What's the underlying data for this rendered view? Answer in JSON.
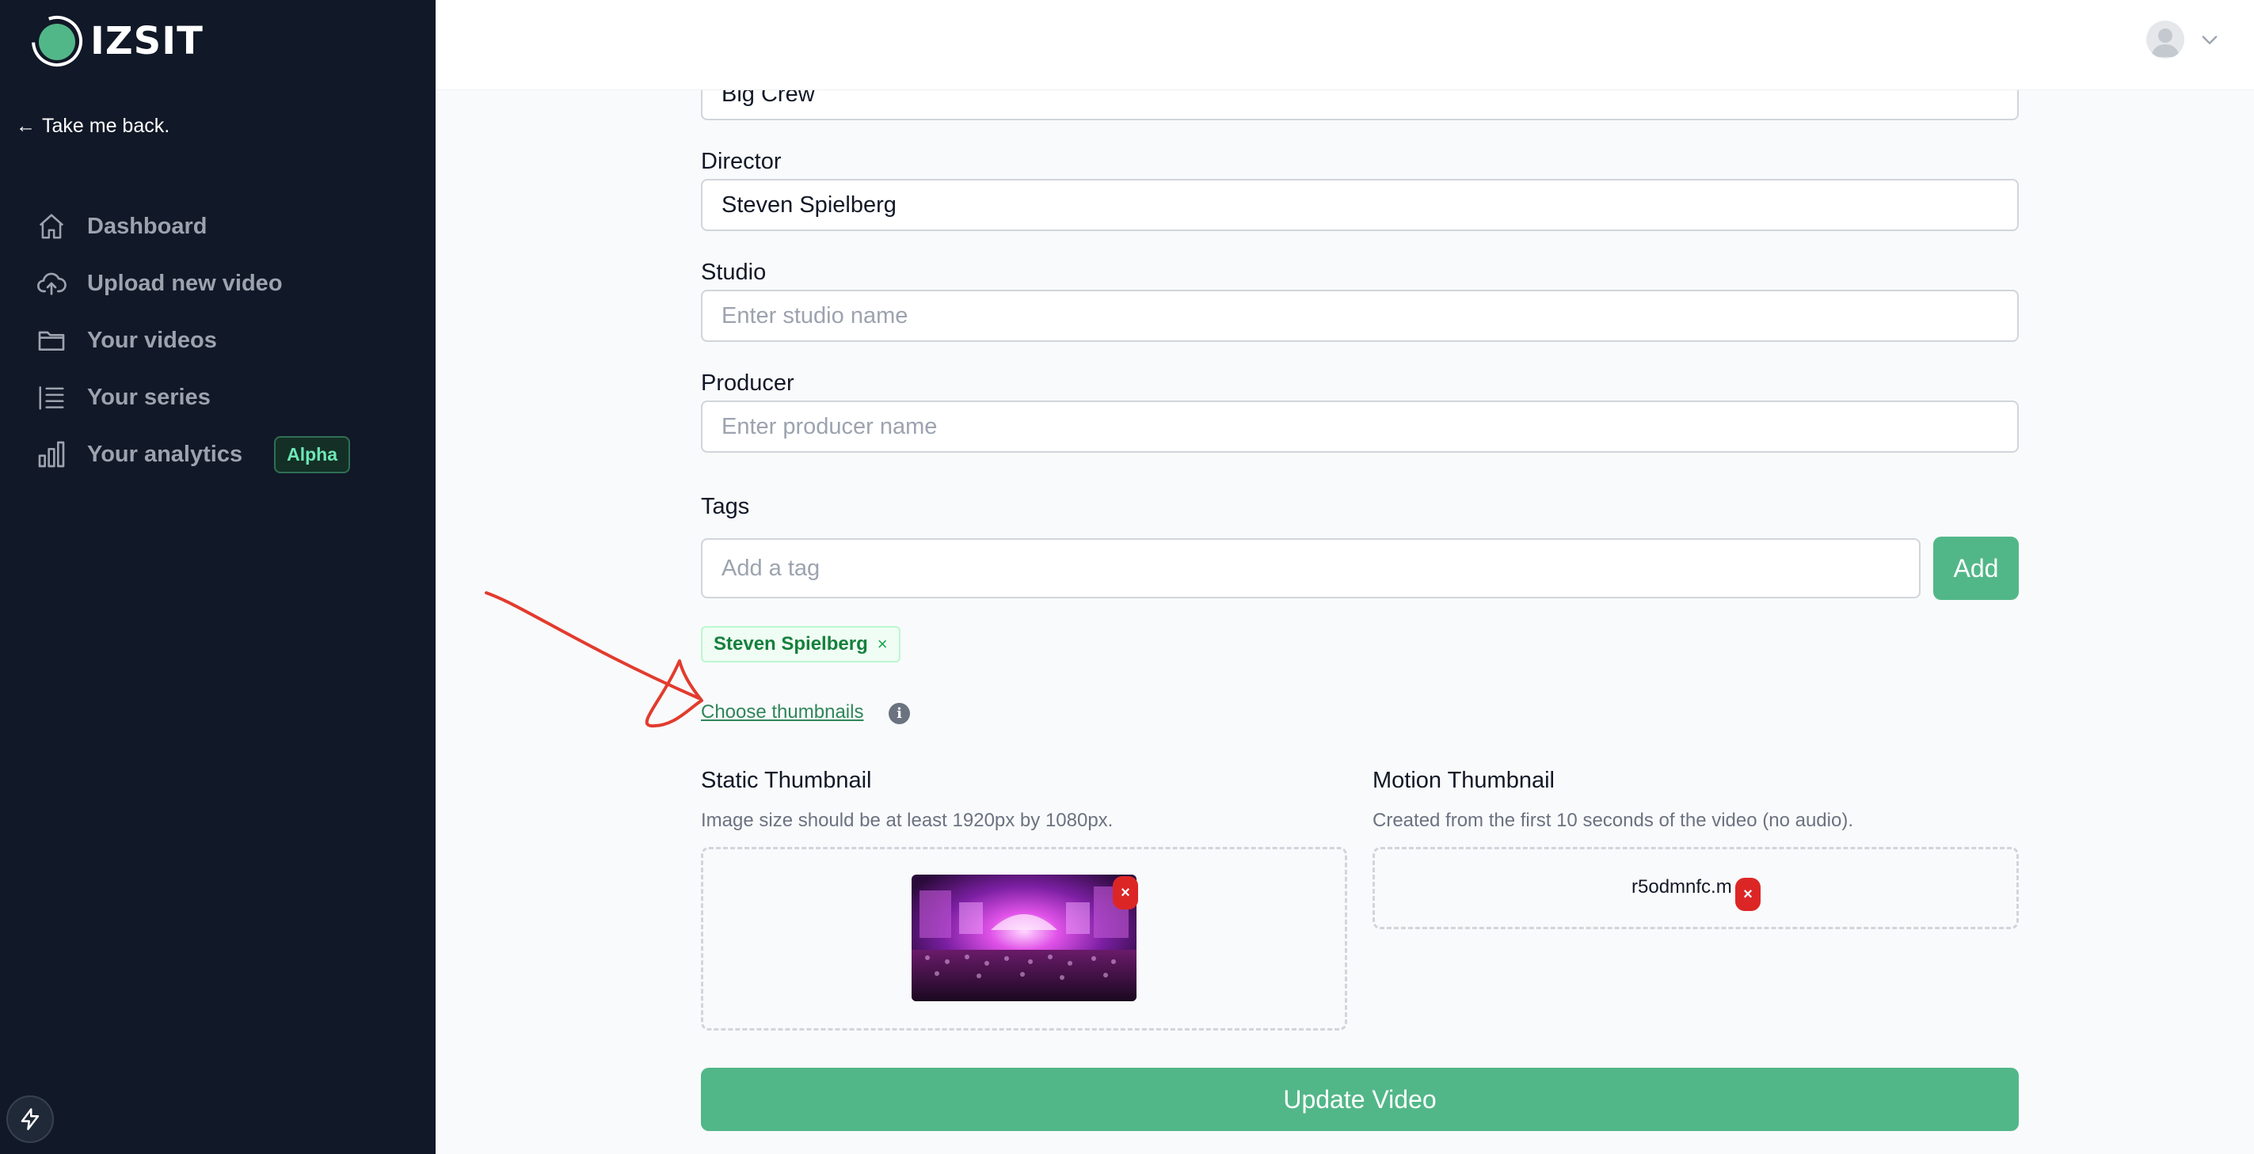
{
  "app": {
    "brand": "IZSIT"
  },
  "sidebar": {
    "back_label": "Take me back.",
    "items": [
      {
        "label": "Dashboard",
        "icon": "home-icon"
      },
      {
        "label": "Upload new video",
        "icon": "cloud-upload-icon"
      },
      {
        "label": "Your videos",
        "icon": "folder-icon"
      },
      {
        "label": "Your series",
        "icon": "list-icon"
      },
      {
        "label": "Your analytics",
        "icon": "bar-chart-icon",
        "badge": "Alpha"
      }
    ]
  },
  "form": {
    "crew_value": "Big Crew",
    "director": {
      "label": "Director",
      "value": "Steven Spielberg"
    },
    "studio": {
      "label": "Studio",
      "placeholder": "Enter studio name"
    },
    "producer": {
      "label": "Producer",
      "placeholder": "Enter producer name"
    },
    "tags": {
      "label": "Tags",
      "placeholder": "Add a tag",
      "add_label": "Add",
      "items": [
        "Steven Spielberg"
      ]
    },
    "choose_thumbnails_label": "Choose thumbnails",
    "static_thumbnail": {
      "title": "Static Thumbnail",
      "hint": "Image size should be at least 1920px by 1080px."
    },
    "motion_thumbnail": {
      "title": "Motion Thumbnail",
      "hint": "Created from the first 10 seconds of the video (no audio).",
      "file_name": "r5odmnfc.m"
    },
    "update_label": "Update Video"
  },
  "colors": {
    "sidebar_bg": "#111827",
    "accent": "#52b788",
    "danger": "#dc2626"
  }
}
